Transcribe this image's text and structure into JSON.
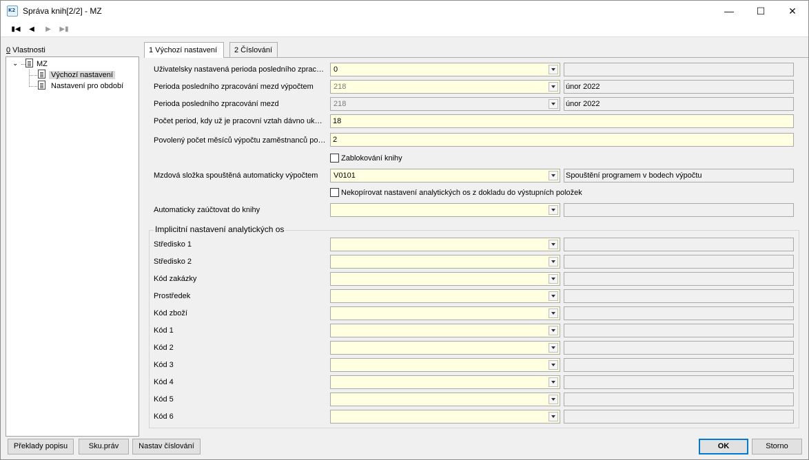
{
  "window": {
    "icon_text": "K2",
    "title": "Správa knih[2/2] - MZ",
    "buttons": {
      "minimize": "—",
      "maximize": "☐",
      "close": "✕"
    }
  },
  "toolbar": {
    "first": "▮◀",
    "prev": "◀",
    "next": "▶",
    "last": "▶▮"
  },
  "left_panel": {
    "label_accel": "0",
    "label_rest": " Vlastnosti",
    "tree": {
      "root": "MZ",
      "items": [
        "Výchozí nastavení",
        "Nastavení pro období"
      ]
    }
  },
  "tabs": [
    {
      "label": "1 Výchozí nastavení",
      "active": true
    },
    {
      "label": "2 Číslování",
      "active": false
    }
  ],
  "form": {
    "uzivatelska_perioda": {
      "label": "Uživatelsky nastavená perioda posledního zpracování",
      "value": "0",
      "desc": ""
    },
    "perioda_vypoctem": {
      "label": "Perioda posledního zpracování mezd výpočtem",
      "value": "218",
      "desc": "únor 2022"
    },
    "perioda_mezd": {
      "label": "Perioda posledního zpracování mezd",
      "value": "218",
      "desc": "únor 2022"
    },
    "pocet_period": {
      "label": "Počet period, kdy už je pracovní vztah dávno ukončen",
      "value": "18"
    },
    "povoleny_pocet": {
      "label": "Povolený počet měsíců výpočtu zaměstnanců po ukončení",
      "value": "2"
    },
    "zablokovani": {
      "label": "Zablokování knihy",
      "checked": false
    },
    "mzdova_slozka": {
      "label": "Mzdová složka spouštěná automaticky výpočtem",
      "value": "V0101",
      "desc": "Spouštění programem v bodech výpočtu"
    },
    "nekopirovat": {
      "label": "Nekopírovat nastavení analytických os z dokladu do výstupních položek",
      "checked": false
    },
    "zauctovat": {
      "label": "Automaticky zaúčtovat do knihy",
      "value": "",
      "desc": ""
    }
  },
  "group": {
    "title": "Implicitní nastavení analytických os",
    "rows": [
      {
        "label": "Středisko 1",
        "value": "",
        "desc": ""
      },
      {
        "label": "Středisko 2",
        "value": "",
        "desc": ""
      },
      {
        "label": "Kód zakázky",
        "value": "",
        "desc": ""
      },
      {
        "label": "Prostředek",
        "value": "",
        "desc": ""
      },
      {
        "label": "Kód zboží",
        "value": "",
        "desc": ""
      },
      {
        "label": "Kód 1",
        "value": "",
        "desc": ""
      },
      {
        "label": "Kód 2",
        "value": "",
        "desc": ""
      },
      {
        "label": "Kód 3",
        "value": "",
        "desc": ""
      },
      {
        "label": "Kód 4",
        "value": "",
        "desc": ""
      },
      {
        "label": "Kód 5",
        "value": "",
        "desc": ""
      },
      {
        "label": "Kód 6",
        "value": "",
        "desc": ""
      }
    ]
  },
  "buttons": {
    "preklady": "Překlady popisu",
    "sku_prav": "Sku.práv",
    "nastav_cislovani": "Nastav číslování",
    "ok": "OK",
    "storno": "Storno"
  },
  "colors": {
    "required_field": "#ffffe1",
    "default_button_border": "#0078d7"
  }
}
